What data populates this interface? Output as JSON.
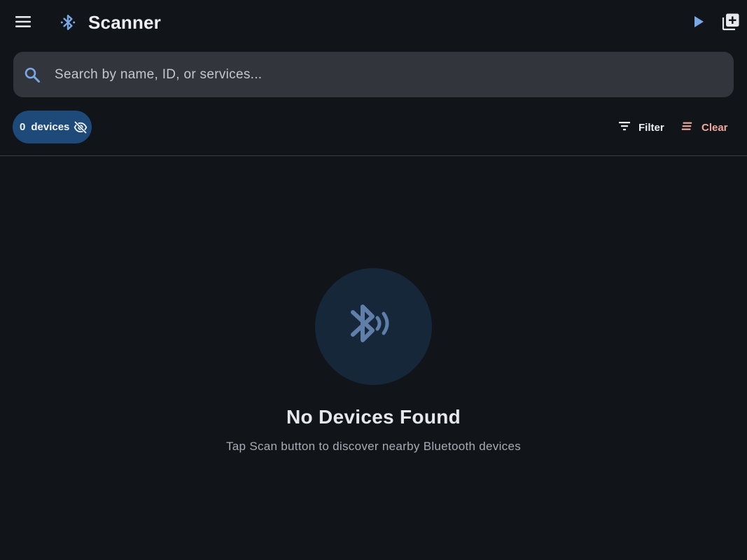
{
  "header": {
    "title": "Scanner",
    "icons": {
      "menu": "menu-icon",
      "brand": "bluetooth-icon",
      "scan": "play-icon",
      "add": "add-box-icon"
    }
  },
  "search": {
    "placeholder": "Search by name, ID, or services...",
    "value": ""
  },
  "toolbar": {
    "device_count": "0",
    "device_label": "devices",
    "visibility_icon": "eye-off-icon",
    "filter_label": "Filter",
    "clear_label": "Clear"
  },
  "empty_state": {
    "icon": "bluetooth-searching-icon",
    "title": "No Devices Found",
    "subtitle": "Tap Scan button to discover nearby Bluetooth devices"
  },
  "colors": {
    "background": "#111419",
    "search_background": "#32353b",
    "chip_background": "#1d4a78",
    "accent_blue": "#7aa7e6",
    "clear_red": "#f2a99e",
    "empty_circle": "#17273a",
    "empty_icon": "#5f7fa8"
  }
}
